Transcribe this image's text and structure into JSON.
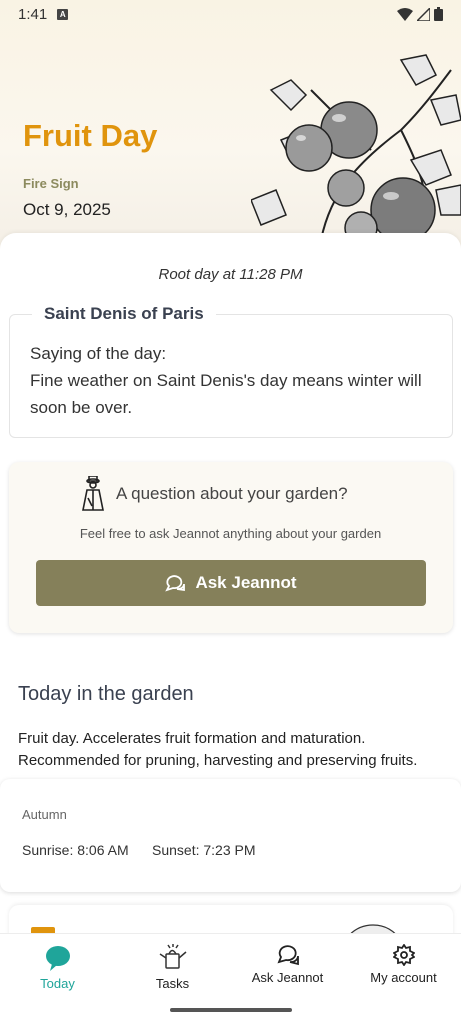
{
  "status_bar": {
    "time": "1:41",
    "notification_badge": "A"
  },
  "hero": {
    "title": "Fruit Day",
    "sign": "Fire Sign",
    "date": "Oct 9, 2025",
    "illustration": "tomato-plant-illustration"
  },
  "root_day": "Root day at 11:28 PM",
  "saint": {
    "name": "Saint Denis of Paris",
    "saying_label": "Saying of the day:",
    "saying": "Fine weather on Saint Denis's day means winter will soon be over."
  },
  "ask": {
    "title": "A question about your garden?",
    "subtitle": "Feel free to ask Jeannot anything about your garden",
    "button_label": "Ask Jeannot"
  },
  "garden": {
    "title": "Today in the garden",
    "description": "Fruit day. Accelerates fruit formation and maturation. Recommended for pruning, harvesting and preserving fruits."
  },
  "sun": {
    "season": "Autumn",
    "sunrise": "Sunrise: 8:06 AM",
    "sunset": "Sunset: 7:23 PM"
  },
  "nav": {
    "items": [
      {
        "label": "Today",
        "icon": "leaf-bubble-icon",
        "active": true
      },
      {
        "label": "Tasks",
        "icon": "watering-can-icon",
        "active": false
      },
      {
        "label": "Ask Jeannot",
        "icon": "chat-bubbles-icon",
        "active": false
      },
      {
        "label": "My account",
        "icon": "gear-icon",
        "active": false
      }
    ]
  },
  "colors": {
    "accent_orange": "#e0940d",
    "olive_button": "#85805a",
    "active_teal": "#1fa59a"
  }
}
